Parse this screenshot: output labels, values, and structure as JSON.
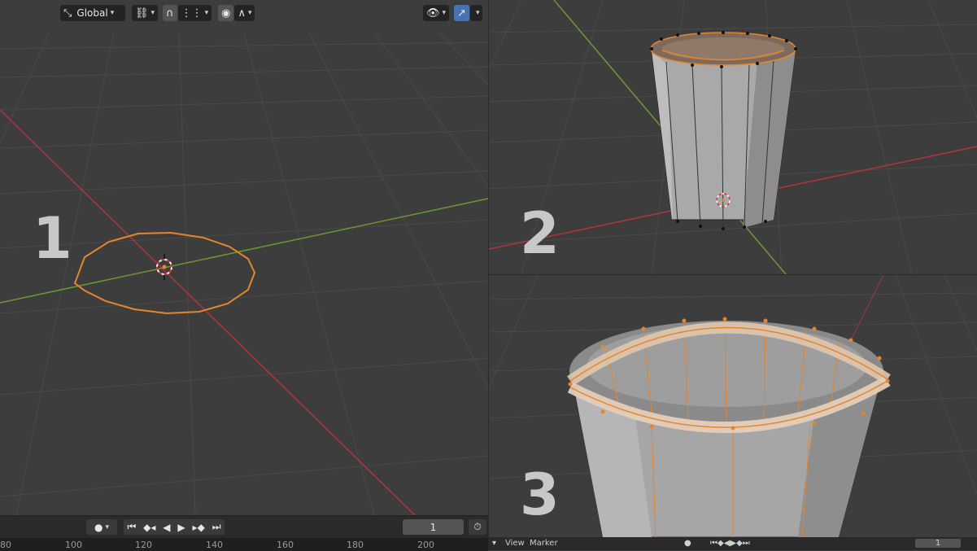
{
  "header": {
    "orientation_icon": "transform-orientation-icon",
    "orientation_label": "Global",
    "pivot_icon": "pivot-link-icon",
    "snap_icon": "snap-magnet-icon",
    "snap_increment_icon": "snap-increment-icon",
    "proportional_icon": "proportional-edit-icon",
    "falloff_icon": "falloff-curve-icon",
    "visibility_icon": "eye-visibility-icon",
    "gizmo_icon": "gizmo-icon"
  },
  "panels": [
    {
      "number": "1"
    },
    {
      "number": "2"
    },
    {
      "number": "3"
    }
  ],
  "timeline": {
    "frame": "1",
    "ruler_labels": [
      "80",
      "100",
      "120",
      "140",
      "160",
      "180",
      "200"
    ]
  },
  "mini_timeline": {
    "view_label": "View",
    "marker_label": "Marker",
    "frame": "1"
  },
  "colors": {
    "x_axis": "#b5333f",
    "y_axis": "#6c9834",
    "selection": "#e5852f",
    "viewport_bg": "#3d3d3d",
    "grid": "#4a4a4a",
    "active_button": "#4772b3"
  }
}
